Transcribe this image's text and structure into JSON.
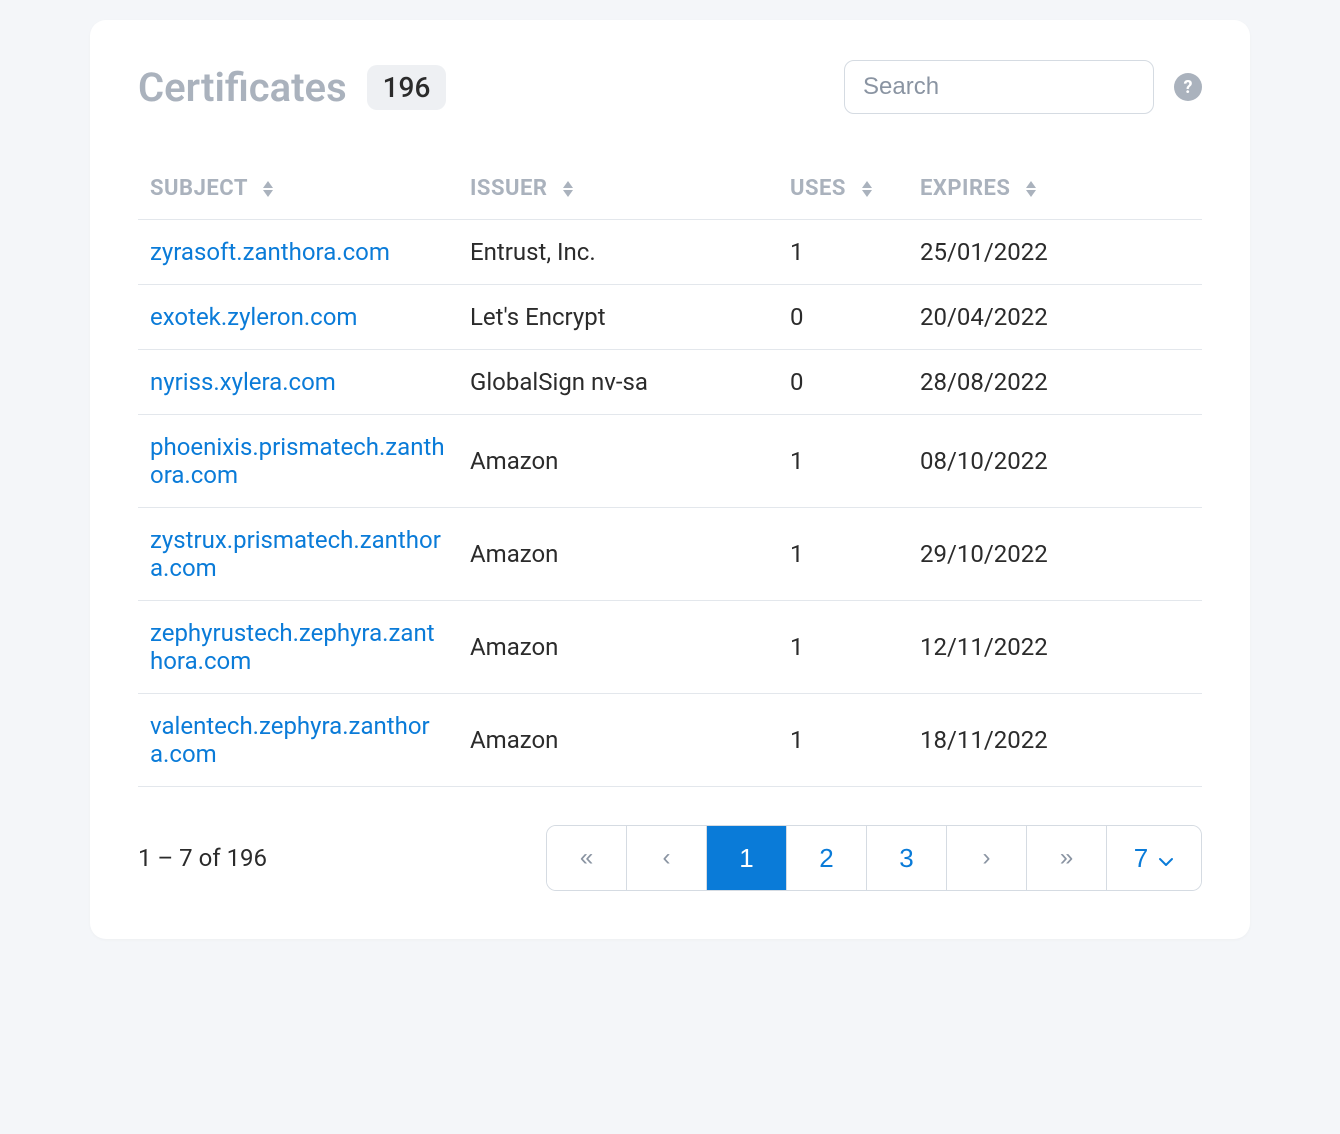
{
  "header": {
    "title": "Certificates",
    "count": "196",
    "search_placeholder": "Search",
    "help_glyph": "?"
  },
  "columns": {
    "subject": "SUBJECT",
    "issuer": "ISSUER",
    "uses": "USES",
    "expires": "EXPIRES"
  },
  "rows": [
    {
      "subject": "zyrasoft.zanthora.com",
      "issuer": "Entrust, Inc.",
      "uses": "1",
      "expires": "25/01/2022"
    },
    {
      "subject": "exotek.zyleron.com",
      "issuer": "Let's Encrypt",
      "uses": "0",
      "expires": "20/04/2022"
    },
    {
      "subject": "nyriss.xylera.com",
      "issuer": "GlobalSign nv-sa",
      "uses": "0",
      "expires": "28/08/2022"
    },
    {
      "subject": "phoenixis.prismatech.zanthora.com",
      "issuer": "Amazon",
      "uses": "1",
      "expires": "08/10/2022"
    },
    {
      "subject": "zystrux.prismatech.zanthora.com",
      "issuer": "Amazon",
      "uses": "1",
      "expires": "29/10/2022"
    },
    {
      "subject": "zephyrustech.zephyra.zanthora.com",
      "issuer": "Amazon",
      "uses": "1",
      "expires": "12/11/2022"
    },
    {
      "subject": "valentech.zephyra.zanthora.com",
      "issuer": "Amazon",
      "uses": "1",
      "expires": "18/11/2022"
    }
  ],
  "footer": {
    "range": "1 – 7 of 196"
  },
  "pager": {
    "first": "«",
    "prev": "‹",
    "pages": [
      "1",
      "2",
      "3"
    ],
    "active_index": 0,
    "next": "›",
    "last": "»",
    "page_size": "7"
  }
}
